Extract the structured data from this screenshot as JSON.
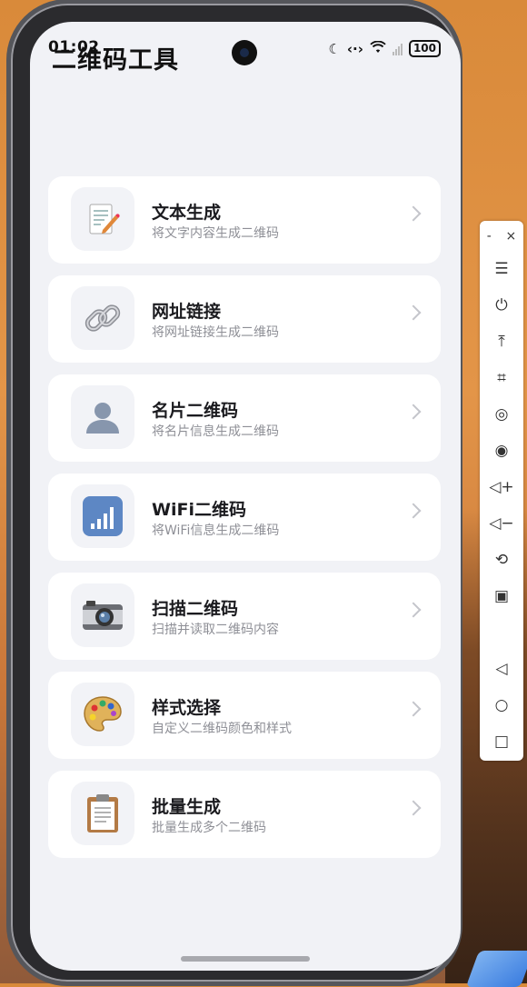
{
  "status_bar": {
    "time": "01:02",
    "battery": "100"
  },
  "app": {
    "title": "二维码工具"
  },
  "menu_items": [
    {
      "title": "文本生成",
      "subtitle": "将文字内容生成二维码",
      "icon": "memo-icon"
    },
    {
      "title": "网址链接",
      "subtitle": "将网址链接生成二维码",
      "icon": "link-icon"
    },
    {
      "title": "名片二维码",
      "subtitle": "将名片信息生成二维码",
      "icon": "person-silhouette-icon"
    },
    {
      "title": "WiFi二维码",
      "subtitle": "将WiFi信息生成二维码",
      "icon": "signal-bars-icon"
    },
    {
      "title": "扫描二维码",
      "subtitle": "扫描并读取二维码内容",
      "icon": "camera-icon"
    },
    {
      "title": "样式选择",
      "subtitle": "自定义二维码颜色和样式",
      "icon": "palette-icon"
    },
    {
      "title": "批量生成",
      "subtitle": "批量生成多个二维码",
      "icon": "clipboard-icon"
    }
  ],
  "side_toolbar": {
    "minimize": "-",
    "close": "×",
    "buttons": [
      "menu-icon",
      "power-icon",
      "to-top-icon",
      "crop-icon",
      "screenshot-icon",
      "record-icon",
      "volume-up-icon",
      "volume-down-icon",
      "rotate-icon",
      "device-switch-icon",
      "back-icon",
      "home-icon",
      "recents-icon"
    ]
  }
}
